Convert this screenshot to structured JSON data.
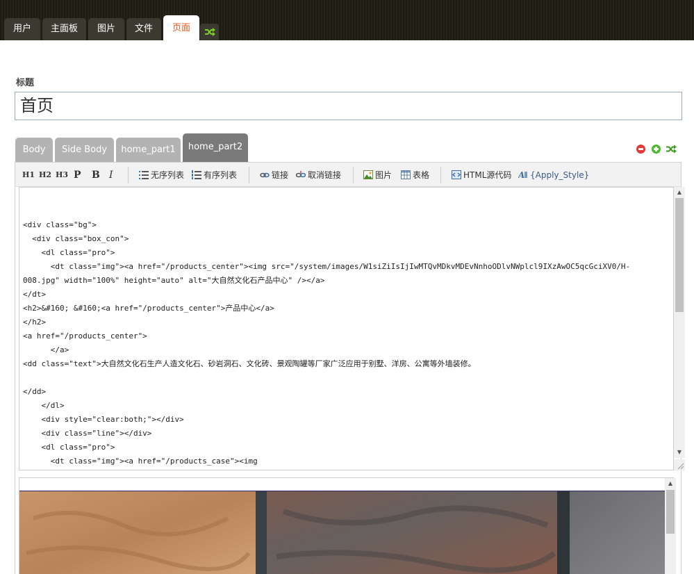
{
  "nav": {
    "tabs": [
      {
        "label": "用户"
      },
      {
        "label": "主面板"
      },
      {
        "label": "图片"
      },
      {
        "label": "文件"
      },
      {
        "label": "页面",
        "active": true
      }
    ],
    "shuffle_icon": "shuffle-icon"
  },
  "page": {
    "title_label": "标题",
    "title_value": "首页"
  },
  "part_tabs": [
    {
      "label": "Body"
    },
    {
      "label": "Side Body"
    },
    {
      "label": "home_part1"
    },
    {
      "label": "home_part2",
      "active": true
    }
  ],
  "part_controls": [
    "remove-icon",
    "add-icon",
    "shuffle-icon"
  ],
  "toolbar": {
    "h1": "H1",
    "h2": "H2",
    "h3": "H3",
    "p": "P",
    "b": "B",
    "i": "I",
    "unordered_list": "无序列表",
    "ordered_list": "有序列表",
    "link": "链接",
    "unlink": "取消链接",
    "image": "图片",
    "table": "表格",
    "html_source": "HTML源代码",
    "apply_style": "{Apply_Style}"
  },
  "code": {
    "lines": [
      "<div class=\"bg\">",
      "  <div class=\"box_con\">",
      "    <dl class=\"pro\">",
      "      <dt class=\"img\"><a href=\"/products_center\"><img src=\"/system/images/W1siZiIsIjIwMTQvMDkvMDEvNnhoODlvNWplcl9IXzAwOC5qcGciXV0/H-",
      "008.jpg\" width=\"100%\" height=\"auto\" alt=\"大自然文化石产品中心\" /></a>",
      "</dt>",
      "<h2>&#160; &#160;<a href=\"/products_center\">产品中心</a>",
      "</h2>",
      "<a href=\"/products_center\">",
      "      </a>",
      "<dd class=\"text\">大自然文化石生产人造文化石、砂岩洞石、文化砖、景观陶罐等厂家广泛应用于别墅、洋房、公寓等外墙装修。",
      "",
      "</dd>",
      "    </dl>",
      "    <div style=\"clear:both;\"></div>",
      "    <div class=\"line\"></div>",
      "    <dl class=\"pro\">",
      "      <dt class=\"img\"><a href=\"/products_case\"><img"
    ]
  },
  "colors": {
    "active_tab_text": "#e05a1a",
    "part_tab": "#b3b3b3",
    "part_tab_active": "#7a7a7a"
  }
}
